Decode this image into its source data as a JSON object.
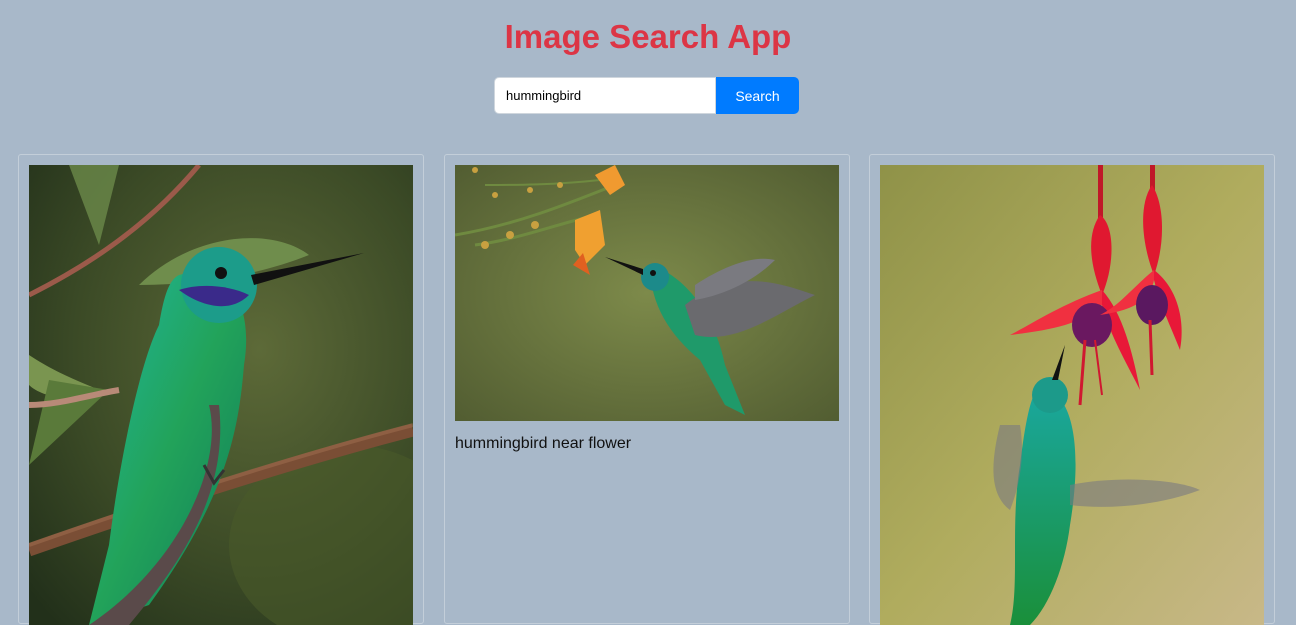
{
  "app": {
    "title": "Image Search App"
  },
  "search": {
    "value": "hummingbird",
    "button_label": "Search"
  },
  "results": [
    {
      "caption": "",
      "icon": "hummingbird-on-branch-photo"
    },
    {
      "caption": "hummingbird near flower",
      "icon": "hummingbird-near-flower-photo"
    },
    {
      "caption": "",
      "icon": "hummingbird-feeding-fuchsia-photo"
    }
  ],
  "colors": {
    "background": "#a8b8c9",
    "title": "#dc3545",
    "button": "#007bff"
  }
}
